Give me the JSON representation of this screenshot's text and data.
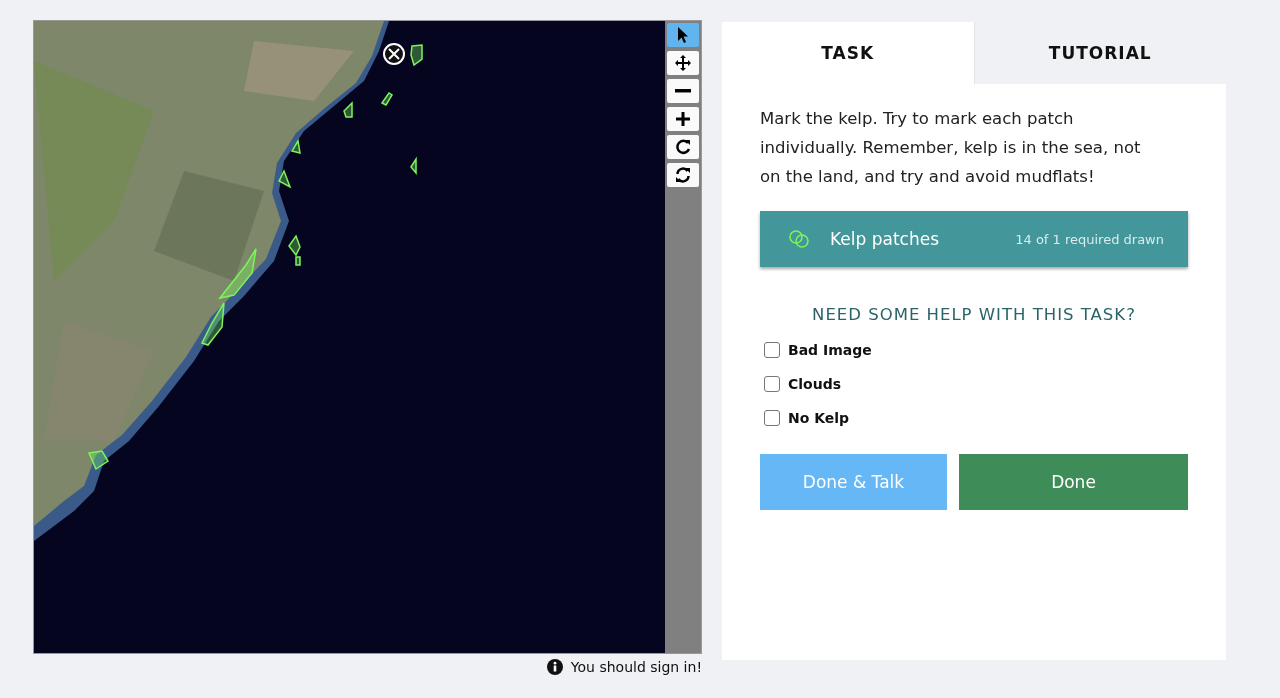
{
  "tools": [
    {
      "kind": "pointer",
      "selected": true
    },
    {
      "kind": "move",
      "selected": false
    },
    {
      "kind": "zoom-out",
      "selected": false
    },
    {
      "kind": "zoom-in",
      "selected": false
    },
    {
      "kind": "rotate",
      "selected": false
    },
    {
      "kind": "reset",
      "selected": false
    }
  ],
  "sign_in_notice": "You should sign in!",
  "tabs": [
    {
      "label": "TASK",
      "selected": true
    },
    {
      "label": "TUTORIAL",
      "selected": false
    }
  ],
  "instructions": "Mark the kelp. Try to mark each patch individually. Remember, kelp is in the sea, not on the land, and try and avoid mudflats!",
  "drawing_tool": {
    "label": "Kelp patches",
    "count": "14 of 1 required drawn",
    "color": "#7cf55b"
  },
  "help_link": "NEED SOME HELP WITH THIS TASK?",
  "checkboxes": [
    {
      "label": "Bad Image",
      "checked": false
    },
    {
      "label": "Clouds",
      "checked": false
    },
    {
      "label": "No Kelp",
      "checked": false
    }
  ],
  "buttons": [
    {
      "label": "Done & Talk",
      "kind": "secondary"
    },
    {
      "label": "Done",
      "kind": "primary"
    }
  ]
}
